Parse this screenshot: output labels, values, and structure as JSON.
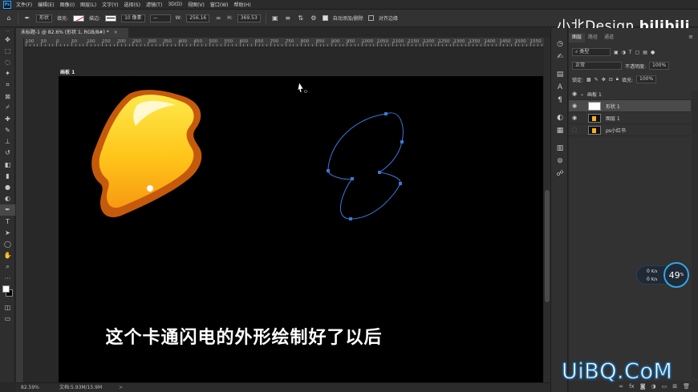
{
  "app": {
    "logo": "Ps"
  },
  "menu": [
    "文件(F)",
    "编辑(E)",
    "图像(I)",
    "图层(L)",
    "文字(Y)",
    "选择(S)",
    "滤镜(T)",
    "3D(D)",
    "视图(V)",
    "窗口(W)",
    "帮助(H)"
  ],
  "options": {
    "mode": "形状",
    "fill_label": "填充:",
    "stroke_label": "描边:",
    "stroke_size": "10 像素",
    "w_label": "W:",
    "w_value": "256.16",
    "h_label": "H:",
    "h_value": "369.53",
    "auto_add_label": "自动添加/删除",
    "align_edges_label": "对齐边缘"
  },
  "brand": "小北Design",
  "document": {
    "tab_title": "未标题-1 @ 82.6% (形状 1, RGB/8#) *",
    "tab_close": "×"
  },
  "ruler": {
    "labels": [
      "100",
      "50",
      "0",
      "50",
      "100",
      "150",
      "200",
      "250",
      "300",
      "350",
      "400",
      "450",
      "500",
      "550",
      "600",
      "650",
      "700",
      "750",
      "800",
      "850",
      "900",
      "950",
      "1000",
      "1050",
      "1100",
      "1150",
      "1200",
      "1250",
      "1300",
      "1350",
      "1400",
      "1450",
      "1500",
      "1550"
    ]
  },
  "canvas": {
    "artboard_label": "画板 1",
    "subtitle": "这个卡通闪电的外形绘制好了以后"
  },
  "status": {
    "zoom": "82.59%",
    "doc_size": "文档:5.93M/15.9M",
    "arrow": ">"
  },
  "panel": {
    "tabs": [
      "图层",
      "路径",
      "通道"
    ],
    "filter_kind": "类型",
    "blend_mode": "正常",
    "opacity_label": "不透明度:",
    "opacity_value": "100%",
    "lock_label": "锁定:",
    "fill_label": "填充:",
    "fill_value": "100%",
    "layers": [
      {
        "name": "画板 1",
        "type": "artboard"
      },
      {
        "name": "形状 1",
        "type": "shape",
        "selected": true
      },
      {
        "name": "图层 1",
        "type": "pixel"
      },
      {
        "name": "ps小红书",
        "type": "pixel"
      }
    ]
  },
  "net": {
    "up": "0",
    "up_unit": "K/s",
    "down": "0",
    "down_unit": "K/s",
    "percent": "49",
    "percent_unit": "%"
  },
  "watermark": "UiBQ.CoM",
  "colors": {
    "accent": "#31a8ff",
    "path": "#3a78d8",
    "canvas": "#000000",
    "bolt_fill": "#f9b418",
    "bolt_edge": "#d96a10"
  }
}
